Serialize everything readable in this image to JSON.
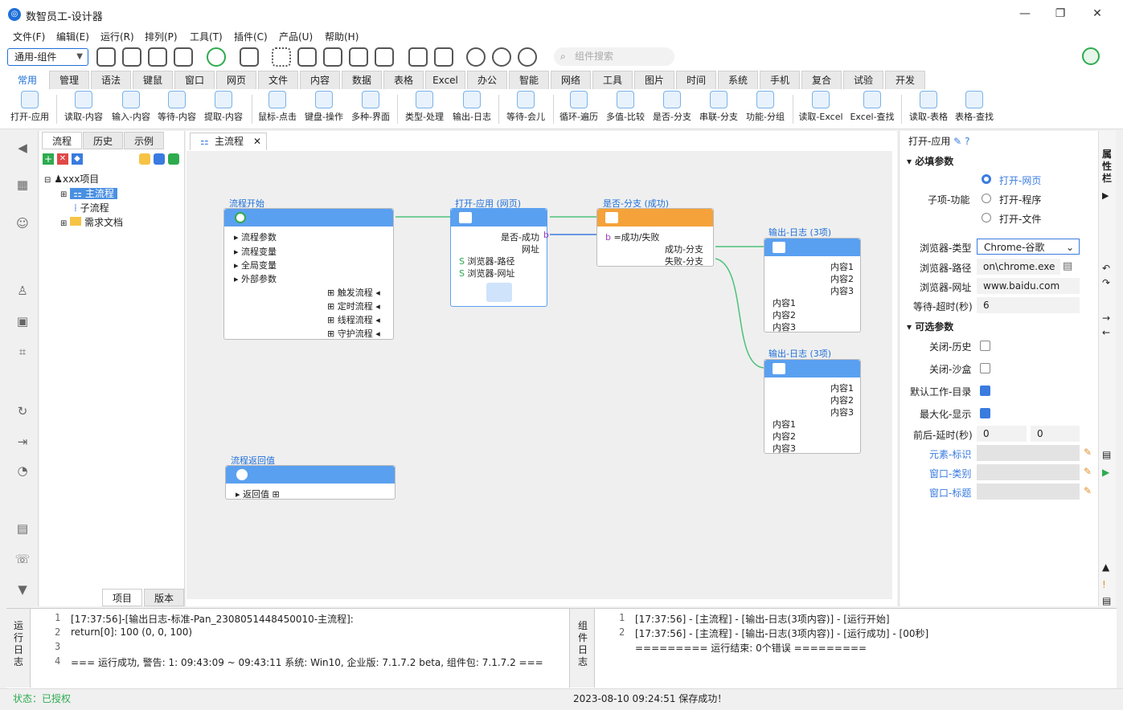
{
  "app": {
    "title": "数智员工-设计器",
    "logo": "logo-icon"
  },
  "menu": [
    "文件(F)",
    "编辑(E)",
    "运行(R)",
    "排列(P)",
    "工具(T)",
    "插件(C)",
    "产品(U)",
    "帮助(H)"
  ],
  "toolbar": {
    "combo": "通用-组件",
    "search_placeholder": "组件搜索"
  },
  "tabs": [
    "常用",
    "管理",
    "语法",
    "键鼠",
    "窗口",
    "网页",
    "文件",
    "内容",
    "数据",
    "表格",
    "Excel",
    "办公",
    "智能",
    "网络",
    "工具",
    "图片",
    "时间",
    "系统",
    "手机",
    "复合",
    "试验",
    "开发"
  ],
  "ribbon": [
    "打开-应用",
    "读取-内容",
    "输入-内容",
    "等待-内容",
    "提取-内容",
    "鼠标-点击",
    "键盘-操作",
    "多种-界面",
    "类型-处理",
    "输出-日志",
    "等待-会儿",
    "循环-遍历",
    "多值-比较",
    "是否-分支",
    "串联-分支",
    "功能-分组",
    "读取-Excel",
    "Excel-查找",
    "读取-表格",
    "表格-查找"
  ],
  "left_panel": {
    "tabs": [
      "流程",
      "历史",
      "示例"
    ],
    "tree": {
      "root": "xxx项目",
      "main": "主流程",
      "sub": "子流程",
      "docs": "需求文档"
    },
    "bottom_tabs": [
      "项目",
      "版本"
    ]
  },
  "doc_tab": "主流程",
  "nodes": {
    "start": {
      "title": "流程开始",
      "rows": [
        "流程参数",
        "流程变量",
        "全局变量",
        "外部参数"
      ],
      "triggers": [
        "触发流程",
        "定时流程",
        "线程流程",
        "守护流程"
      ]
    },
    "open": {
      "title": "打开-应用 (网页)",
      "out1": "是否-成功",
      "out2": "网址",
      "in1": "浏览器-路径",
      "in2": "浏览器-网址",
      "port_b": "b",
      "port_s": "S"
    },
    "branch": {
      "title": "是否-分支 (成功)",
      "cond": "=成功/失败",
      "out1": "成功-分支",
      "out2": "失败-分支"
    },
    "log1": {
      "title": "输出-日志 (3项)",
      "outs": [
        "内容1",
        "内容2",
        "内容3"
      ],
      "ins": [
        "内容1",
        "内容2",
        "内容3"
      ]
    },
    "log2": {
      "title": "输出-日志 (3项)",
      "outs": [
        "内容1",
        "内容2",
        "内容3"
      ],
      "ins": [
        "内容1",
        "内容2",
        "内容3"
      ]
    },
    "ret": {
      "title": "流程返回值",
      "row": "返回值"
    }
  },
  "props": {
    "header": "打开-应用",
    "required": "必填参数",
    "optional": "可选参数",
    "sub_func_label": "子项-功能",
    "options": [
      "打开-网页",
      "打开-程序",
      "打开-文件"
    ],
    "browser_type_label": "浏览器-类型",
    "browser_type": "Chrome-谷歌",
    "browser_path_label": "浏览器-路径",
    "browser_path": "on\\chrome.exe",
    "browser_url_label": "浏览器-网址",
    "browser_url": "www.baidu.com",
    "timeout_label": "等待-超时(秒)",
    "timeout": "6",
    "close_history": "关闭-历史",
    "close_sandbox": "关闭-沙盒",
    "default_dir": "默认工作-目录",
    "maximize": "最大化-显示",
    "delay_label": "前后-延时(秒)",
    "delay1": "0",
    "delay2": "0",
    "elem_id": "元素-标识",
    "win_class": "窗口-类别",
    "win_title": "窗口-标题",
    "rail": "属性栏"
  },
  "log_left": {
    "label": "运行日志",
    "lines": [
      {
        "n": "1",
        "t": "[17:37:56]-[输出日志-标准-Pan_23080514484500​10-主流程]:"
      },
      {
        "n": "2",
        "t": "return[0]: 100 (0, 0, 100)"
      },
      {
        "n": "3",
        "t": ""
      },
      {
        "n": "4",
        "t": "=== 运行成功, 警告: 1: 09:43:09 ~ 09:43:11  系统: Win10, 企业版: 7.1.7.2 beta, 组件包: 7.1.7.2 ==="
      }
    ]
  },
  "log_right": {
    "label": "组件日志",
    "lines": [
      {
        "n": "1",
        "t": "[17:37:56] - [主流程] - [输出-日志(3项内容)] - [运行开始]"
      },
      {
        "n": "2",
        "t": "[17:37:56] - [主流程] - [输出-日志(3项内容)] - [运行成功] - [00秒]"
      },
      {
        "n": "",
        "t": "========= 运行结束: 0个错误 ========="
      }
    ]
  },
  "status": {
    "left": "状态：已授权",
    "center": "2023-08-10 09:24:51 保存成功！"
  },
  "colors": {
    "accent": "#1e6fd9",
    "node_blue": "#5aa0f0",
    "node_orange": "#f5a23a",
    "edge": "#4cc27a",
    "green": "#2eab4f"
  }
}
